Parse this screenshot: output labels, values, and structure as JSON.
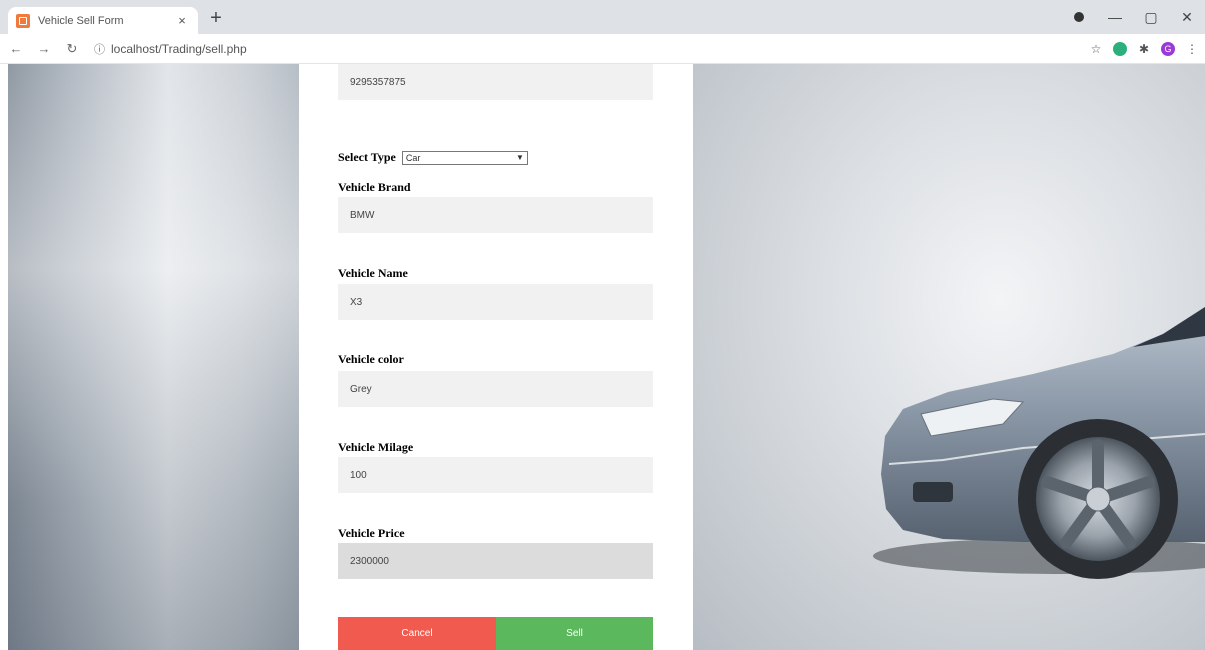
{
  "browser": {
    "tab_title": "Vehicle Sell Form",
    "tab_close": "×",
    "new_tab": "+",
    "url": "localhost/Trading/sell.php",
    "profile_initial": "G"
  },
  "form": {
    "phone_value": "9295357875",
    "select_type_label": "Select Type",
    "select_type_value": "Car",
    "brand_label": "Vehicle Brand",
    "brand_value": "BMW",
    "name_label": "Vehicle Name",
    "name_value": "X3",
    "color_label": "Vehicle color",
    "color_value": "Grey",
    "milage_label": "Vehicle Milage",
    "milage_value": "100",
    "price_label": "Vehicle Price",
    "price_value": "2300000",
    "cancel_label": "Cancel",
    "sell_label": "Sell"
  },
  "colors": {
    "cancel": "#f05a4f",
    "sell": "#5cb85c",
    "field_bg": "#f1f1f1",
    "car_body": "#8a97a6"
  }
}
